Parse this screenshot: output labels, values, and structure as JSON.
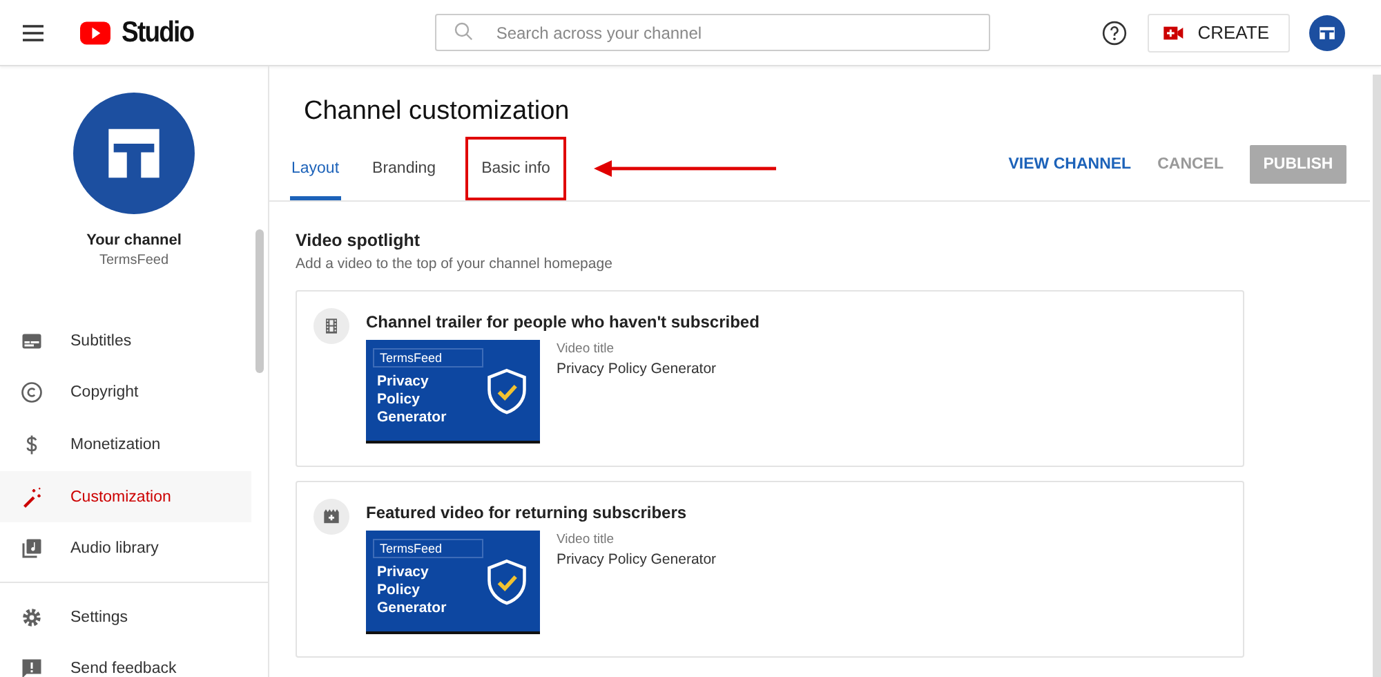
{
  "header": {
    "logo_text": "Studio",
    "search": {
      "placeholder": "Search across your channel"
    },
    "create_button": "CREATE"
  },
  "sidebar": {
    "channel": {
      "label": "Your channel",
      "name": "TermsFeed"
    },
    "items": [
      {
        "label": "Subtitles",
        "kind": "subtitles",
        "selected": false
      },
      {
        "label": "Copyright",
        "kind": "copyright",
        "selected": false
      },
      {
        "label": "Monetization",
        "kind": "monetization",
        "selected": false
      },
      {
        "label": "Customization",
        "kind": "customization",
        "selected": true
      },
      {
        "label": "Audio library",
        "kind": "audio",
        "selected": false
      }
    ],
    "footer_items": [
      {
        "label": "Settings",
        "kind": "settings"
      },
      {
        "label": "Send feedback",
        "kind": "feedback"
      }
    ]
  },
  "page": {
    "title": "Channel customization",
    "tabs": [
      {
        "label": "Layout",
        "selected": true,
        "highlighted": false
      },
      {
        "label": "Branding",
        "selected": false,
        "highlighted": false
      },
      {
        "label": "Basic info",
        "selected": false,
        "highlighted": true
      }
    ],
    "actions": [
      {
        "label": "VIEW CHANNEL",
        "kind": "link",
        "disabled": false
      },
      {
        "label": "CANCEL",
        "kind": "link",
        "disabled": true
      },
      {
        "label": "PUBLISH",
        "kind": "filled",
        "disabled": true
      }
    ],
    "section": {
      "title": "Video spotlight",
      "description": "Add a video to the top of your channel homepage",
      "slots": [
        {
          "kind": "trailer",
          "title": "Channel trailer for people who haven't subscribed",
          "thumbnail": {
            "brand": "TermsFeed",
            "text": "Privacy Policy Generator"
          },
          "video_title_label": "Video title",
          "video_title": "Privacy Policy Generator"
        },
        {
          "kind": "featured",
          "title": "Featured video for returning subscribers",
          "thumbnail": {
            "brand": "TermsFeed",
            "text": "Privacy Policy Generator"
          },
          "video_title_label": "Video title",
          "video_title": "Privacy Policy Generator"
        }
      ]
    }
  }
}
